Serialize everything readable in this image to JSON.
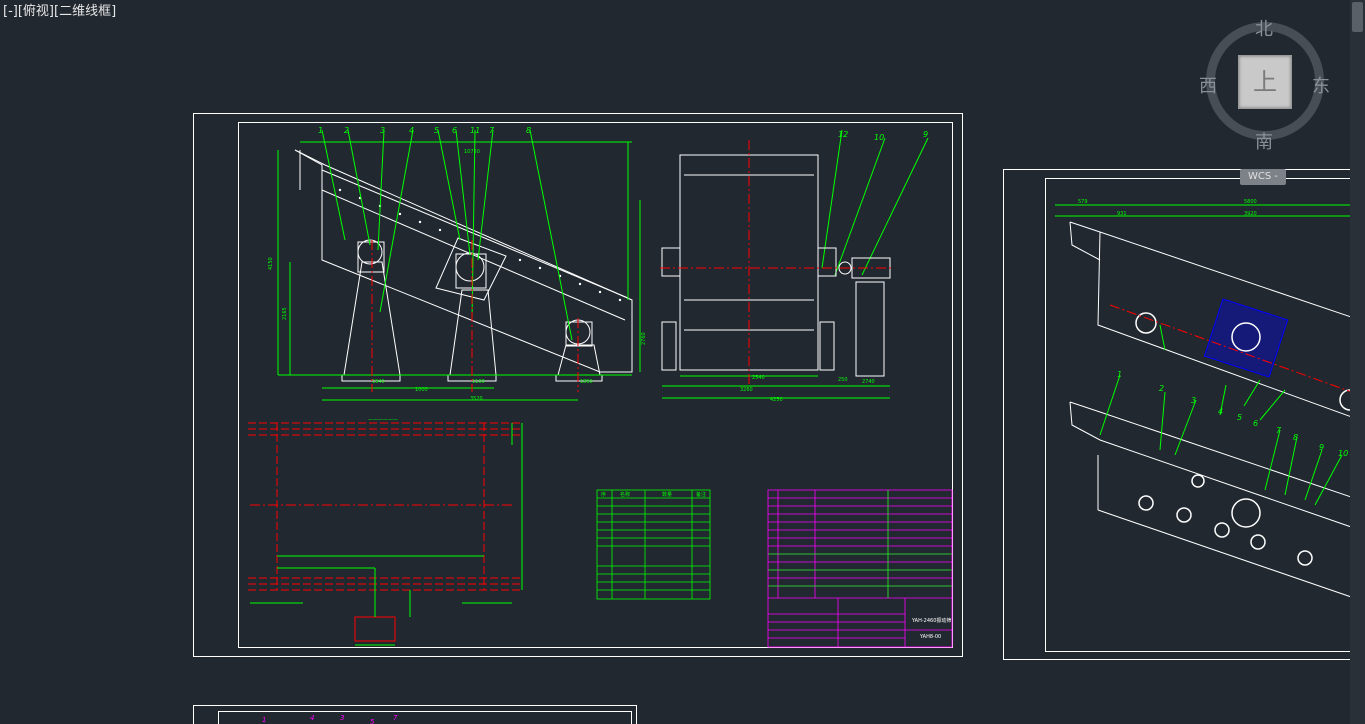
{
  "viewport": {
    "menu": "[-]",
    "view": "[俯视]",
    "style": "[二维线框]"
  },
  "viewcube": {
    "north": "北",
    "south": "南",
    "west": "西",
    "east": "东",
    "face": "上",
    "wcs": "WCS -"
  },
  "drawing": {
    "part_numbers": [
      "1",
      "2",
      "3",
      "4",
      "5",
      "6",
      "11",
      "7",
      "8",
      "12",
      "10",
      "9"
    ],
    "dims_left": [
      "4150",
      "2165",
      "1000",
      "3520",
      "1940",
      "1100",
      "1890",
      "2760",
      "10750"
    ],
    "dims_right": [
      "2540",
      "3260",
      "4250",
      "250",
      "2740"
    ],
    "table_headers": [
      "序",
      "名称",
      "数量",
      "备注"
    ],
    "title_block": "YAH-2460振动筛",
    "drawing_no": "YAH8-00",
    "sheet2_dims": [
      "579",
      "931",
      "5800",
      "3920"
    ],
    "sheet2_parts": [
      "1",
      "2",
      "3",
      "4",
      "5",
      "6",
      "7",
      "8",
      "9",
      "10"
    ]
  },
  "colors": {
    "background": "#212830",
    "frame": "#ffffff",
    "green": "#00ff00",
    "red": "#ff0000",
    "magenta": "#ff00ff",
    "blue": "#0000ff"
  }
}
